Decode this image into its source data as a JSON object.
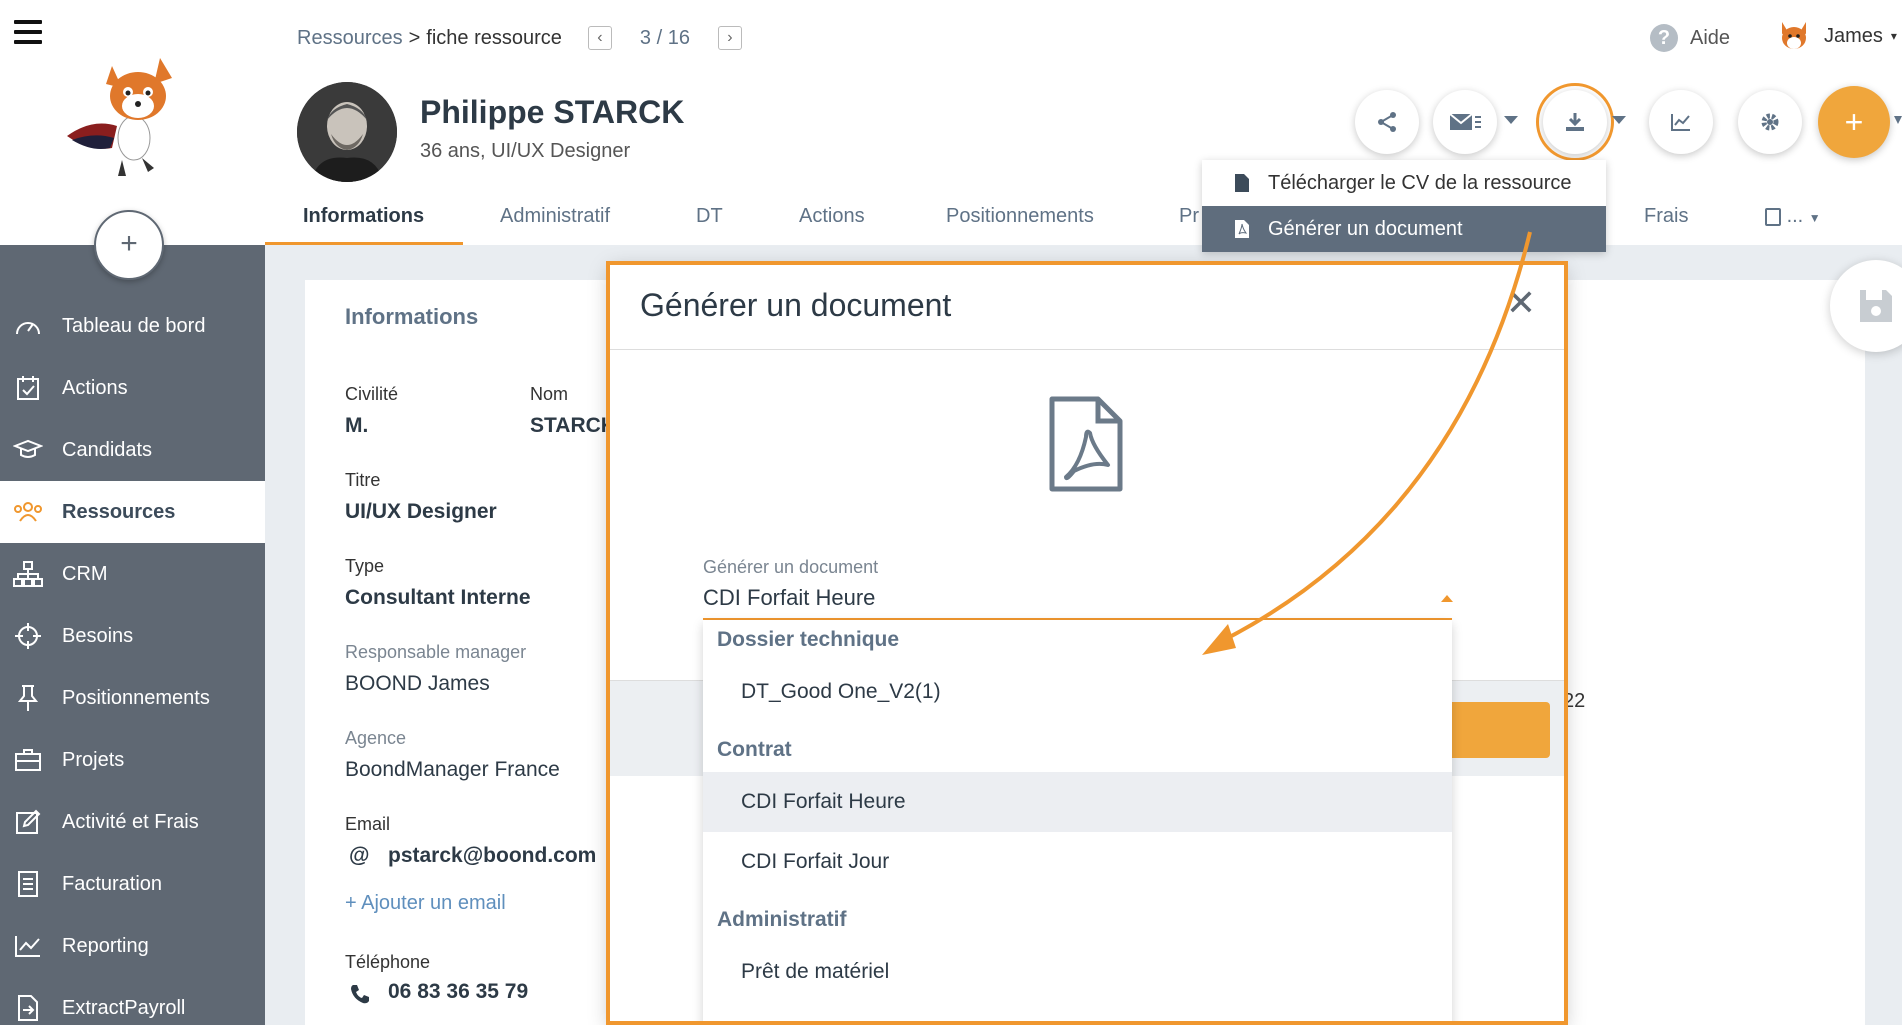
{
  "sidebar": {
    "items": [
      {
        "label": "Tableau de bord",
        "icon": "dashboard-icon"
      },
      {
        "label": "Actions",
        "icon": "calendar-check-icon"
      },
      {
        "label": "Candidats",
        "icon": "graduation-cap-icon"
      },
      {
        "label": "Ressources",
        "icon": "users-icon",
        "active": true
      },
      {
        "label": "CRM",
        "icon": "sitemap-icon"
      },
      {
        "label": "Besoins",
        "icon": "crosshair-icon"
      },
      {
        "label": "Positionnements",
        "icon": "pin-icon"
      },
      {
        "label": "Projets",
        "icon": "briefcase-icon"
      },
      {
        "label": "Activité et Frais",
        "icon": "edit-icon"
      },
      {
        "label": "Facturation",
        "icon": "invoice-icon"
      },
      {
        "label": "Reporting",
        "icon": "chart-line-icon"
      },
      {
        "label": "ExtractPayroll",
        "icon": "file-export-icon"
      }
    ]
  },
  "breadcrumb": {
    "link": "Ressources",
    "separator": ">",
    "current": "fiche ressource",
    "pager": "3 / 16"
  },
  "header": {
    "help": "Aide",
    "user": "James"
  },
  "person": {
    "name": "Philippe STARCK",
    "subtitle": "36 ans, UI/UX Designer"
  },
  "tabs": [
    "Informations",
    "Administratif",
    "DT",
    "Actions",
    "Positionnements",
    "Pr",
    "Frais",
    "..."
  ],
  "download_menu": {
    "items": [
      {
        "label": "Télécharger le CV de la ressource"
      },
      {
        "label": "Générer un document",
        "highlighted": true
      }
    ]
  },
  "info": {
    "title": "Informations",
    "civilite_label": "Civilité",
    "civilite_value": "M.",
    "nom_label": "Nom",
    "nom_value": "STARCK",
    "titre_label": "Titre",
    "titre_value": "UI/UX Designer",
    "type_label": "Type",
    "type_value": "Consultant Interne",
    "manager_label": "Responsable manager",
    "manager_value": "BOOND James",
    "agence_label": "Agence",
    "agence_value": "BoondManager France",
    "email_label": "Email",
    "email_value": "pstarck@boond.com",
    "add_email": "+ Ajouter un email",
    "tel_label": "Téléphone",
    "tel_value": "06 83 36 35 79"
  },
  "modal": {
    "title": "Générer un document",
    "field_label": "Générer un document",
    "field_value": "CDI Forfait Heure",
    "behind_text": "22",
    "groups": [
      {
        "label": "Dossier technique",
        "options": [
          "DT_Good One_V2(1)"
        ]
      },
      {
        "label": "Contrat",
        "options": [
          "CDI Forfait Heure",
          "CDI Forfait Jour"
        ]
      },
      {
        "label": "Administratif",
        "options": [
          "Prêt de matériel"
        ]
      }
    ],
    "selected_option": "CDI Forfait Heure"
  },
  "colors": {
    "accent": "#f0972e",
    "sidebar": "#5f6873",
    "text_muted": "#5f7286"
  }
}
